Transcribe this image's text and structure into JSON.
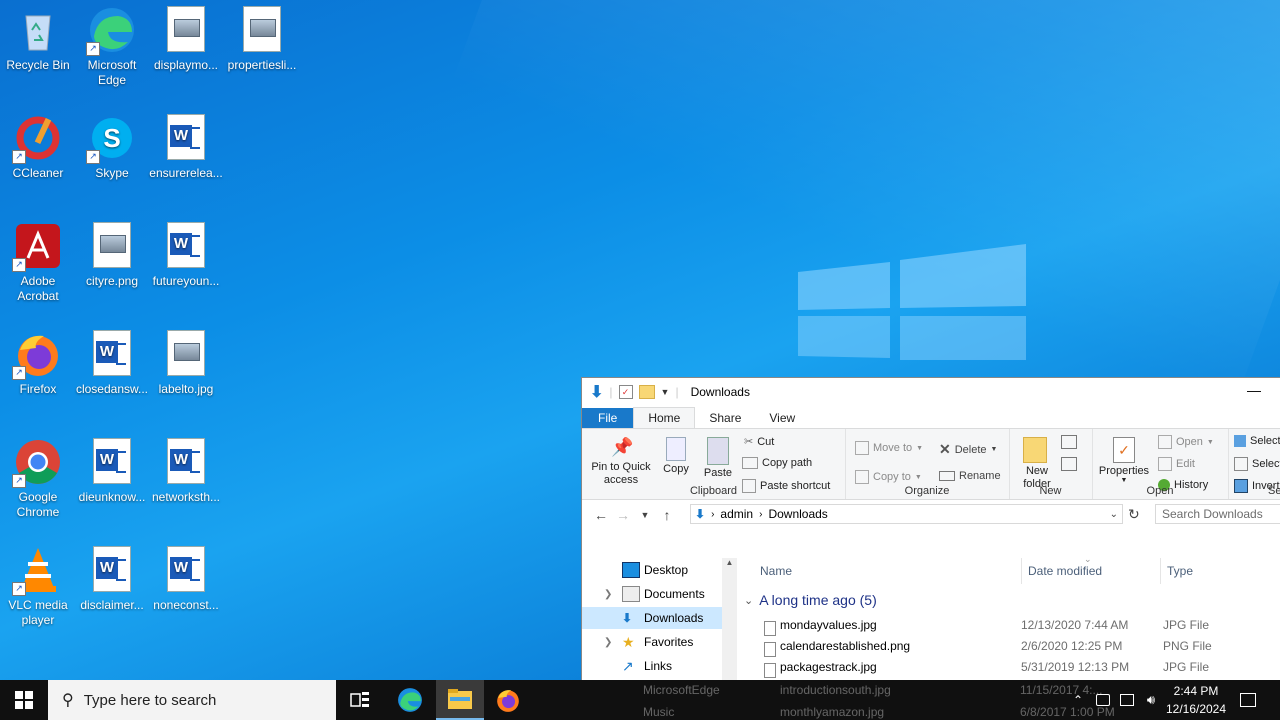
{
  "desktop": {
    "icons": [
      {
        "label": "Recycle Bin"
      },
      {
        "label": "Microsoft Edge"
      },
      {
        "label": "displaymo..."
      },
      {
        "label": "propertiesli..."
      },
      {
        "label": "CCleaner"
      },
      {
        "label": "Skype"
      },
      {
        "label": "ensurerelea..."
      },
      {
        "label": "Adobe Acrobat"
      },
      {
        "label": "cityre.png"
      },
      {
        "label": "futureyoun..."
      },
      {
        "label": "Firefox"
      },
      {
        "label": "closedansw..."
      },
      {
        "label": "labelto.jpg"
      },
      {
        "label": "Google Chrome"
      },
      {
        "label": "dieunknow..."
      },
      {
        "label": "networksth..."
      },
      {
        "label": "VLC media player"
      },
      {
        "label": "disclaimer..."
      },
      {
        "label": "noneconst..."
      }
    ]
  },
  "explorer": {
    "title": "Downloads",
    "tabs": [
      "File",
      "Home",
      "Share",
      "View"
    ],
    "ribbon": {
      "clipboard": {
        "pin": "Pin to Quick access",
        "copy": "Copy",
        "paste": "Paste",
        "cut": "Cut",
        "copy_path": "Copy path",
        "paste_shortcut": "Paste shortcut",
        "label": "Clipboard"
      },
      "organize": {
        "move_to": "Move to",
        "copy_to": "Copy to",
        "delete": "Delete",
        "rename": "Rename",
        "label": "Organize"
      },
      "new": {
        "new_folder": "New folder",
        "label": "New"
      },
      "open": {
        "properties": "Properties",
        "open": "Open",
        "edit": "Edit",
        "history": "History",
        "label": "Open"
      },
      "select": {
        "select_all": "Select",
        "select_none": "Select",
        "invert": "Invert",
        "label": "Se"
      }
    },
    "address": {
      "crumbs": [
        "admin",
        "Downloads"
      ],
      "search_placeholder": "Search Downloads"
    },
    "nav_items": [
      {
        "label": "Desktop"
      },
      {
        "label": "Documents"
      },
      {
        "label": "Downloads"
      },
      {
        "label": "Favorites"
      },
      {
        "label": "Links"
      },
      {
        "label": "MicrosoftEdge"
      },
      {
        "label": "Music"
      }
    ],
    "columns": [
      "Name",
      "Date modified",
      "Type"
    ],
    "group_header": "A long time ago (5)",
    "files": [
      {
        "name": "mondayvalues.jpg",
        "date": "12/13/2020 7:44 AM",
        "type": "JPG File"
      },
      {
        "name": "calendarestablished.png",
        "date": "2/6/2020 12:25 PM",
        "type": "PNG File"
      },
      {
        "name": "packagestrack.jpg",
        "date": "5/31/2019 12:13 PM",
        "type": "JPG File"
      },
      {
        "name": "introductionsouth.jpg",
        "date": "11/15/2017 4:...",
        "type": ""
      },
      {
        "name": "monthlyamazon.jpg",
        "date": "6/8/2017 1:00 PM",
        "type": ""
      }
    ]
  },
  "taskbar": {
    "search_placeholder": "Type here to search",
    "time": "2:44 PM",
    "date": "12/16/2024"
  }
}
